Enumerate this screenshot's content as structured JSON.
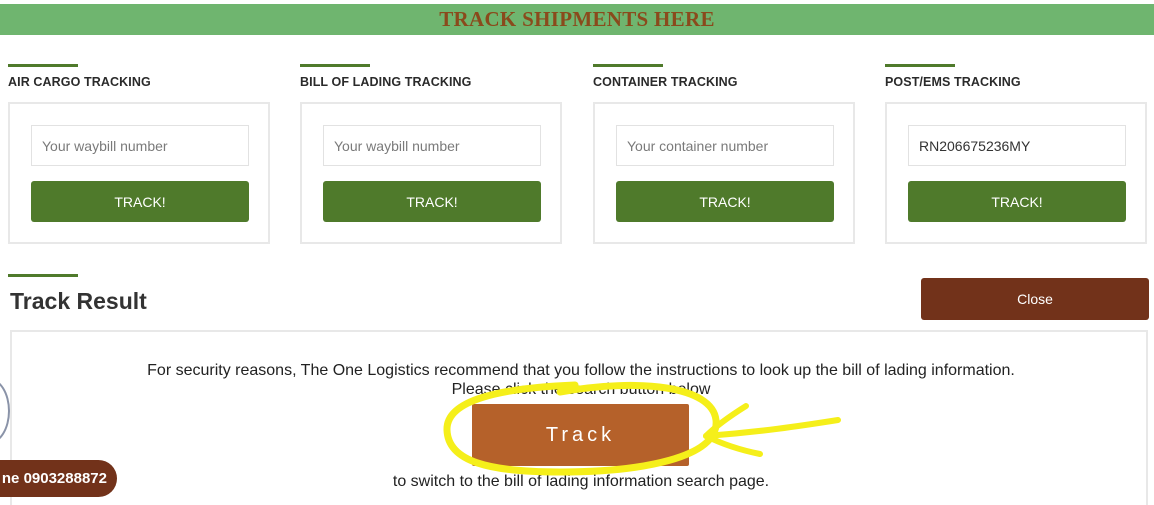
{
  "banner": {
    "title": "TRACK SHIPMENTS HERE"
  },
  "cards": [
    {
      "label": "AIR CARGO TRACKING",
      "input_value": "",
      "placeholder": "Your waybill number",
      "button": "TRACK!"
    },
    {
      "label": "BILL OF LADING TRACKING",
      "input_value": "",
      "placeholder": "Your waybill number",
      "button": "TRACK!"
    },
    {
      "label": "CONTAINER TRACKING",
      "input_value": "",
      "placeholder": "Your container number",
      "button": "TRACK!"
    },
    {
      "label": "POST/EMS TRACKING",
      "input_value": "RN206675236MY",
      "placeholder": "",
      "button": "TRACK!"
    }
  ],
  "result": {
    "title": "Track Result",
    "close_label": "Close",
    "notice_line1": "For security reasons, The One Logistics recommend that you follow the instructions to look up the bill of lading information.",
    "notice_line2": "Please click the search button below",
    "track_label": "Track",
    "notice_line3": "to switch to the bill of lading information search page."
  },
  "hotline": {
    "text": "ne 0903288872"
  },
  "colors": {
    "banner": "#6fb56f",
    "banner_text": "#8a4a1c",
    "green_button": "#4f7a2b",
    "close_button": "#72321a",
    "track_button": "#b5612a",
    "highlight": "#f5ef1a"
  }
}
